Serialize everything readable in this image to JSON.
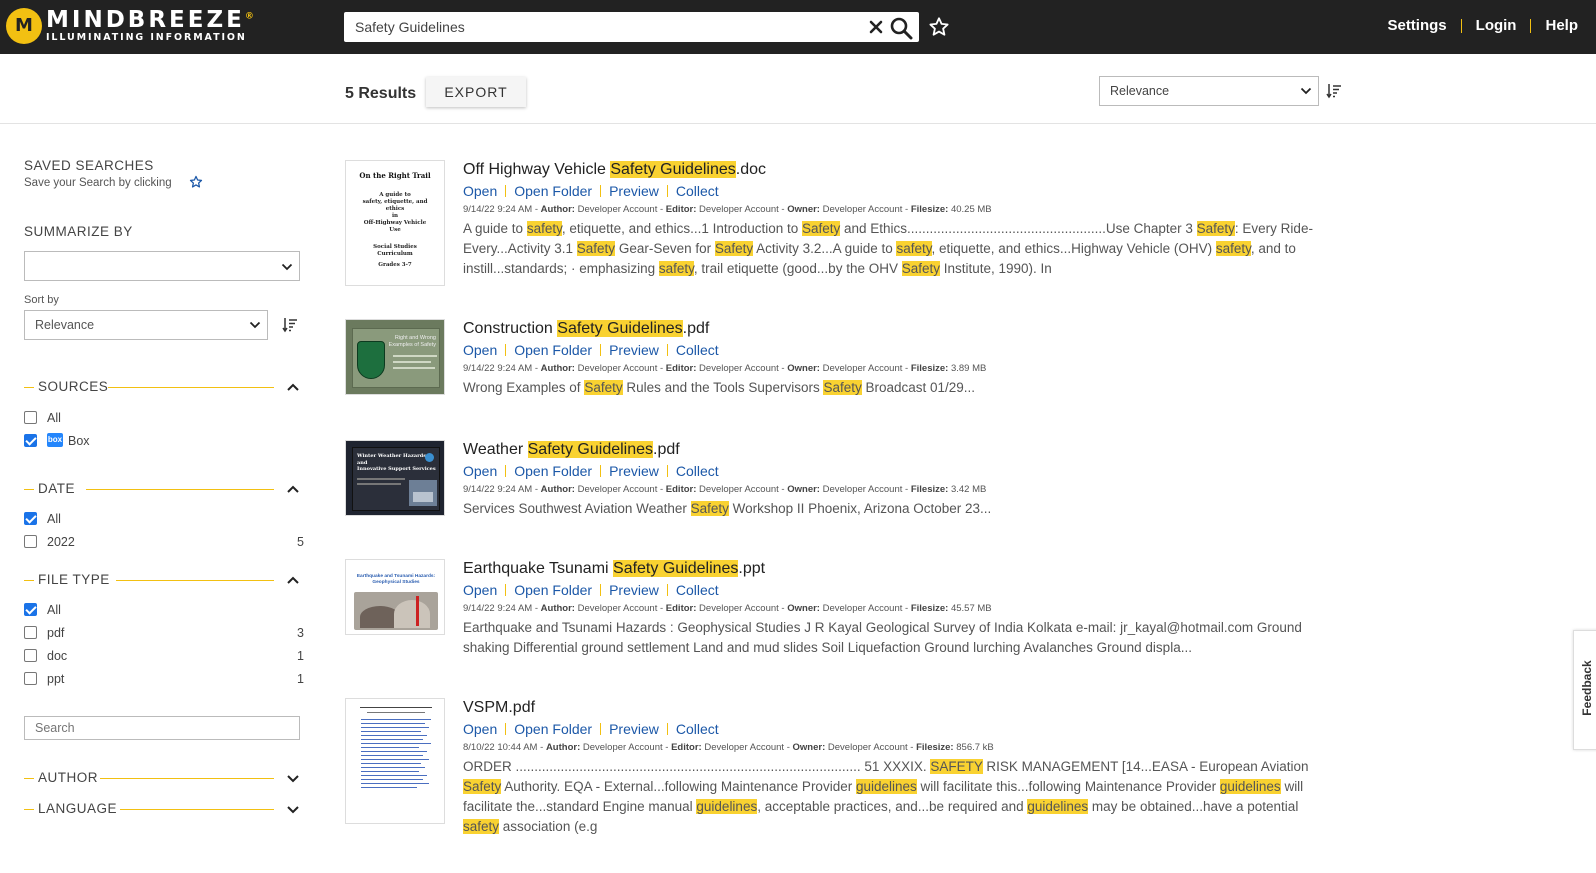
{
  "brand": {
    "name": "MINDBREEZE",
    "mark": "®",
    "tagline": "ILLUMINATING INFORMATION",
    "accent": "#f2c012",
    "header_bg": "#222222"
  },
  "search": {
    "value": "Safety Guidelines"
  },
  "nav": {
    "settings": "Settings",
    "login": "Login",
    "help": "Help"
  },
  "results_bar": {
    "count_label": "5 Results",
    "export_label": "EXPORT",
    "sort_value": "Relevance"
  },
  "sidebar": {
    "saved_searches_title": "SAVED SEARCHES",
    "saved_searches_hint": "Save your Search by clicking",
    "summarize_title": "SUMMARIZE BY",
    "summarize_value": "",
    "sort_by_label": "Sort by",
    "sort_by_value": "Relevance",
    "sources": {
      "title": "SOURCES",
      "items": [
        {
          "label": "All",
          "checked": false
        },
        {
          "label": "Box",
          "checked": true,
          "badge": "box"
        }
      ]
    },
    "date": {
      "title": "DATE",
      "items": [
        {
          "label": "All",
          "checked": true,
          "count": ""
        },
        {
          "label": "2022",
          "checked": false,
          "count": "5"
        }
      ]
    },
    "file_type": {
      "title": "FILE TYPE",
      "items": [
        {
          "label": "All",
          "checked": true,
          "count": ""
        },
        {
          "label": "pdf",
          "checked": false,
          "count": "3"
        },
        {
          "label": "doc",
          "checked": false,
          "count": "1"
        },
        {
          "label": "ppt",
          "checked": false,
          "count": "1"
        }
      ],
      "search_placeholder": "Search"
    },
    "author_title": "AUTHOR",
    "language_title": "LANGUAGE"
  },
  "actions": {
    "open": "Open",
    "open_folder": "Open Folder",
    "preview": "Preview",
    "collect": "Collect"
  },
  "meta_labels": {
    "author": "Author:",
    "editor": "Editor:",
    "owner": "Owner:",
    "filesize": "Filesize:"
  },
  "results": [
    {
      "title_pre": "Off Highway Vehicle ",
      "title_hl": "Safety Guidelines",
      "title_post": ".doc",
      "date": "9/14/22 9:24 AM",
      "author": "Developer Account",
      "editor": "Developer Account",
      "owner": "Developer Account",
      "filesize": "40.25 MB",
      "thumb": {
        "title": "On the Right Trail",
        "line1": "A guide to",
        "line2": "safety, etiquette, and",
        "line3": "ethics",
        "line4": "in",
        "line5": "Off-Highway Vehicle",
        "line6": "Use",
        "line7": "Social Studies",
        "line8": "Curriculum",
        "line9": "Grades 3-7"
      },
      "snippet": [
        [
          "A guide to ",
          0
        ],
        [
          "safety",
          1
        ],
        [
          ", etiquette, and ethics...1 Introduction to ",
          0
        ],
        [
          "Safety",
          1
        ],
        [
          " and Ethics.....................................................Use Chapter 3 ",
          0
        ],
        [
          "Safety",
          1
        ],
        [
          ": Every Ride-Every...Activity 3.1 ",
          0
        ],
        [
          "Safety",
          1
        ],
        [
          " Gear-Seven for ",
          0
        ],
        [
          "Safety",
          1
        ],
        [
          " Activity 3.2...A guide to ",
          0
        ],
        [
          "safety",
          1
        ],
        [
          ", etiquette, and ethics...Highway Vehicle (OHV) ",
          0
        ],
        [
          "safety",
          1
        ],
        [
          ", and to instill...standards; · emphasizing ",
          0
        ],
        [
          "safety",
          1
        ],
        [
          ", trail etiquette (good...by the OHV ",
          0
        ],
        [
          "Safety",
          1
        ],
        [
          " Institute, 1990). In",
          0
        ]
      ]
    },
    {
      "title_pre": "Construction ",
      "title_hl": "Safety Guidelines",
      "title_post": ".pdf",
      "date": "9/14/22 9:24 AM",
      "author": "Developer Account",
      "editor": "Developer Account",
      "owner": "Developer Account",
      "filesize": "3.89 MB",
      "thumb": {
        "line1": "Right and Wrong",
        "line2": "Examples of Safety"
      },
      "snippet": [
        [
          "Wrong Examples of ",
          0
        ],
        [
          "Safety",
          1
        ],
        [
          " Rules and the Tools Supervisors ",
          0
        ],
        [
          "Safety",
          1
        ],
        [
          " Broadcast 01/29...",
          0
        ]
      ]
    },
    {
      "title_pre": "Weather ",
      "title_hl": "Safety Guidelines",
      "title_post": ".pdf",
      "date": "9/14/22 9:24 AM",
      "author": "Developer Account",
      "editor": "Developer Account",
      "owner": "Developer Account",
      "filesize": "3.42 MB",
      "thumb": {
        "line1": "Winter Weather Hazards",
        "line2": "and",
        "line3": "Innovative Support Services"
      },
      "snippet": [
        [
          "Services Southwest Aviation Weather ",
          0
        ],
        [
          "Safety",
          1
        ],
        [
          " Workshop II Phoenix, Arizona October 23...",
          0
        ]
      ]
    },
    {
      "title_pre": "Earthquake Tsunami ",
      "title_hl": "Safety Guidelines",
      "title_post": ".ppt",
      "date": "9/14/22 9:24 AM",
      "author": "Developer Account",
      "editor": "Developer Account",
      "owner": "Developer Account",
      "filesize": "45.57 MB",
      "thumb": {
        "line1": "Earthquake and Tsunami Hazards:",
        "line2": "Geophysical Studies"
      },
      "snippet": [
        [
          "Earthquake and Tsunami Hazards : Geophysical Studies J R Kayal Geological Survey of India Kolkata e-mail: jr_kayal@hotmail.com Ground shaking Differential ground settlement Land and mud slides Soil Liquefaction Ground lurching Avalanches Ground displa...",
          0
        ]
      ]
    },
    {
      "title_pre": "VSPM.pdf",
      "title_hl": "",
      "title_post": "",
      "date": "8/10/22 10:44 AM",
      "author": "Developer Account",
      "editor": "Developer Account",
      "owner": "Developer Account",
      "filesize": "856.7 kB",
      "thumb": {},
      "snippet": [
        [
          "ORDER ............................................................................................ 51 XXXIX. ",
          0
        ],
        [
          "SAFETY",
          1
        ],
        [
          " RISK MANAGEMENT [14...EASA - European Aviation ",
          0
        ],
        [
          "Safety",
          1
        ],
        [
          " Authority. EQA - External...following Maintenance Provider ",
          0
        ],
        [
          "guidelines",
          1
        ],
        [
          " will facilitate this...following Maintenance Provider ",
          0
        ],
        [
          "guidelines",
          1
        ],
        [
          " will facilitate the...standard Engine manual ",
          0
        ],
        [
          "guidelines",
          1
        ],
        [
          ", acceptable practices, and...be required and ",
          0
        ],
        [
          "guidelines",
          1
        ],
        [
          " may be obtained...have a potential ",
          0
        ],
        [
          "safety",
          1
        ],
        [
          " association (e.g",
          0
        ]
      ]
    }
  ],
  "feedback_label": "Feedback"
}
